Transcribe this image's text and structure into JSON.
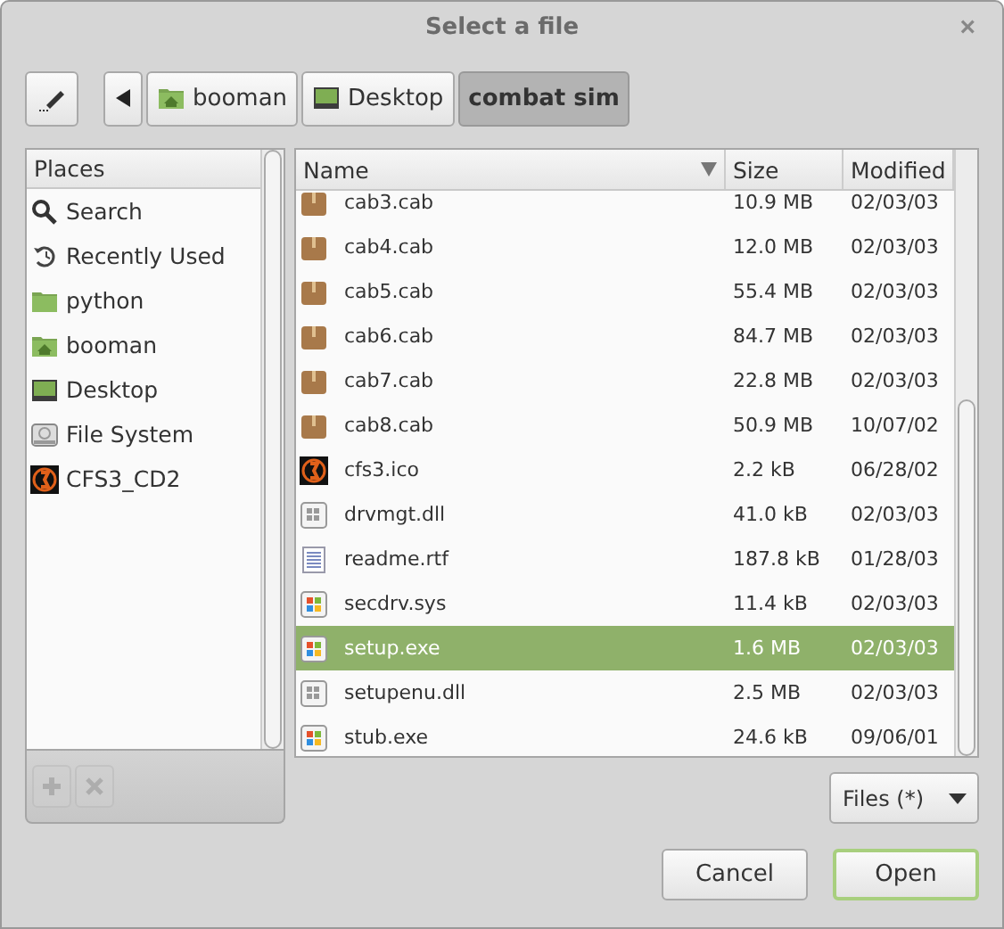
{
  "window": {
    "title": "Select a file",
    "close": "×"
  },
  "path_bar": {
    "items": [
      {
        "label": "booman",
        "kind": "home",
        "selected": false
      },
      {
        "label": "Desktop",
        "kind": "desktop",
        "selected": false
      },
      {
        "label": "combat sim",
        "kind": "plain",
        "selected": true
      }
    ]
  },
  "places": {
    "header": "Places",
    "items": [
      {
        "label": "Search",
        "kind": "search"
      },
      {
        "label": "Recently Used",
        "kind": "recent"
      },
      {
        "label": "python",
        "kind": "folder"
      },
      {
        "label": "booman",
        "kind": "home"
      },
      {
        "label": "Desktop",
        "kind": "desktop"
      },
      {
        "label": "File System",
        "kind": "drive"
      },
      {
        "label": "CFS3_CD2",
        "kind": "disc"
      }
    ],
    "buttons": [
      {
        "kind": "add",
        "disabled": true
      },
      {
        "kind": "remove",
        "disabled": true
      }
    ]
  },
  "files": {
    "columns": [
      "Name",
      "Size",
      "Modified"
    ],
    "rows": [
      {
        "name": "cab3.cab",
        "size": "10.9 MB",
        "modified": "02/03/03",
        "kind": "archive",
        "selected": false
      },
      {
        "name": "cab4.cab",
        "size": "12.0 MB",
        "modified": "02/03/03",
        "kind": "archive",
        "selected": false
      },
      {
        "name": "cab5.cab",
        "size": "55.4 MB",
        "modified": "02/03/03",
        "kind": "archive",
        "selected": false
      },
      {
        "name": "cab6.cab",
        "size": "84.7 MB",
        "modified": "02/03/03",
        "kind": "archive",
        "selected": false
      },
      {
        "name": "cab7.cab",
        "size": "22.8 MB",
        "modified": "02/03/03",
        "kind": "archive",
        "selected": false
      },
      {
        "name": "cab8.cab",
        "size": "50.9 MB",
        "modified": "10/07/02",
        "kind": "archive",
        "selected": false
      },
      {
        "name": "cfs3.ico",
        "size": "2.2 kB",
        "modified": "06/28/02",
        "kind": "disc",
        "selected": false
      },
      {
        "name": "drvmgt.dll",
        "size": "41.0 kB",
        "modified": "02/03/03",
        "kind": "library",
        "selected": false
      },
      {
        "name": "readme.rtf",
        "size": "187.8 kB",
        "modified": "01/28/03",
        "kind": "document",
        "selected": false
      },
      {
        "name": "secdrv.sys",
        "size": "11.4 kB",
        "modified": "02/03/03",
        "kind": "program",
        "selected": false
      },
      {
        "name": "setup.exe",
        "size": "1.6 MB",
        "modified": "02/03/03",
        "kind": "program",
        "selected": true
      },
      {
        "name": "setupenu.dll",
        "size": "2.5 MB",
        "modified": "02/03/03",
        "kind": "library",
        "selected": false
      },
      {
        "name": "stub.exe",
        "size": "24.6 kB",
        "modified": "09/06/01",
        "kind": "program",
        "selected": false
      }
    ]
  },
  "filter": {
    "value": "Files (*)"
  },
  "buttons": [
    {
      "label": "Cancel",
      "default": false
    },
    {
      "label": "Open",
      "default": true
    }
  ]
}
